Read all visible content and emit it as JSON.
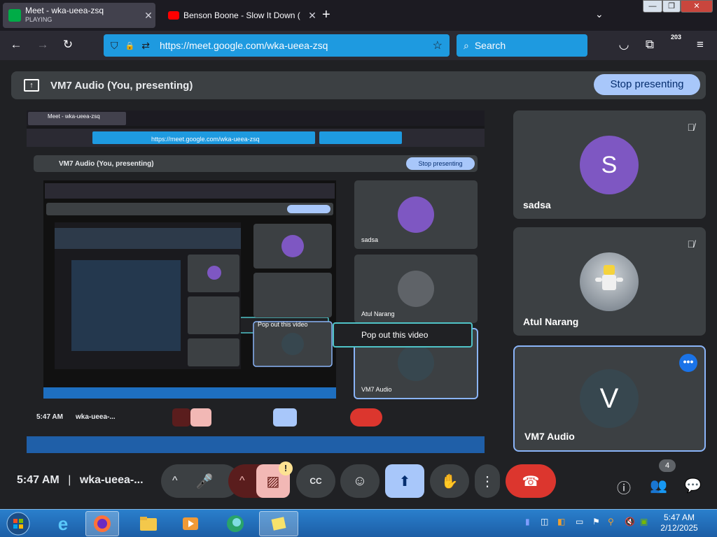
{
  "browser": {
    "tabs": [
      {
        "title": "Meet - wka-ueea-zsq",
        "subtitle": "PLAYING",
        "close": "✕"
      },
      {
        "title": "Benson Boone - Slow It Down (",
        "close": "✕"
      }
    ],
    "new_tab": "+",
    "list_all_tabs": "⌄",
    "window_controls": {
      "minimize": "—",
      "restore": "❐",
      "close": "✕"
    },
    "url": "https://meet.google.com/wka-ueea-zsq",
    "search_placeholder": "Search",
    "extension_badge": "203",
    "nav_icons": {
      "back": "←",
      "forward": "→",
      "reload": "↻",
      "shield": "⛉",
      "lock": "🔒",
      "permissions": "⇄",
      "bookmark": "☆",
      "pocket": "◡",
      "extensions": "⧉",
      "menu": "≡",
      "search": "⌕"
    }
  },
  "meet": {
    "presenting_label": "VM7 Audio (You, presenting)",
    "present_icon": "↑",
    "stop_presenting": "Stop presenting",
    "participants": [
      {
        "name": "sadsa",
        "initial": "S",
        "color": "#7e57c2",
        "muted": true
      },
      {
        "name": "Atul Narang",
        "initial": "",
        "color": "#5f6368",
        "muted": true
      },
      {
        "name": "VM7 Audio",
        "initial": "V",
        "color": "#37474f",
        "muted": false
      }
    ],
    "more_options": "•••",
    "mic_off_icon": "🎙̸",
    "controls": {
      "time": "5:47 AM",
      "separator": "|",
      "meeting_code": "wka-ueea-...",
      "up_arrow": "^",
      "mic": "🎤",
      "cam_warning": "!",
      "camera_off": "▨",
      "captions": "CC",
      "emoji": "☺",
      "present": "⬆",
      "raise_hand": "✋",
      "more": "⋮",
      "hangup": "☎",
      "info": "ⓘ",
      "people": "👥",
      "people_count": "4",
      "chat": "💬"
    },
    "shared_screen": {
      "url": "https://meet.google.com/wka-ueea-zsq",
      "presenting_label": "VM7 Audio (You, presenting)",
      "stop_presenting": "Stop presenting",
      "pop_out": "Pop out this video",
      "time": "5:47 AM",
      "meeting_code": "wka-ueea-...",
      "participants": [
        "sadsa",
        "Atul Narang",
        "VM7 Audio"
      ]
    }
  },
  "taskbar": {
    "time": "5:47 AM",
    "date": "2/12/2025",
    "start_icon": "windows-start-icon",
    "apps": [
      "internet-explorer",
      "firefox",
      "file-explorer",
      "media-player",
      "edge",
      "notes"
    ]
  }
}
